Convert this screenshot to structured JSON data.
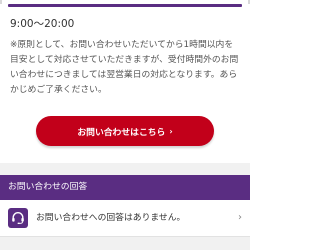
{
  "support": {
    "hours": "9:00～20:00",
    "note": "※原則として、お問い合わせいただいてから1時間以内を目安として対応させていただきますが、受付時間外のお問い合わせにつきましては翌営業日の対応となります。あらかじめご了承ください。",
    "contact_button_label": "お問い合わせはこちら",
    "contact_button_arrow": "›"
  },
  "replies": {
    "header": "お問い合わせの回答",
    "empty_message": "お問い合わせへの回答はありません。",
    "chevron": "›"
  },
  "colors": {
    "brand_purple": "#5a2d82",
    "button_red": "#c2001a"
  },
  "icons": {
    "reply": "headset-icon"
  }
}
